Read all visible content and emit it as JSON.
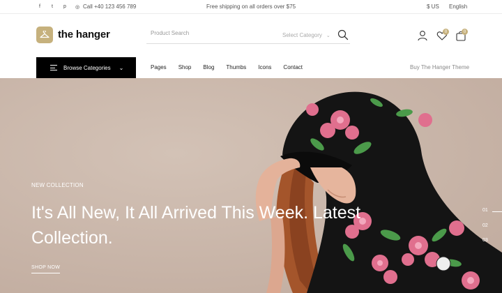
{
  "topbar": {
    "social": [
      {
        "icon": "facebook-icon",
        "glyph": "f"
      },
      {
        "icon": "twitter-icon",
        "glyph": "t"
      },
      {
        "icon": "pinterest-icon",
        "glyph": "p"
      },
      {
        "icon": "instagram-icon",
        "glyph": "◎"
      }
    ],
    "phone": "Call +40 123 456 789",
    "shipping": "Free shipping on all orders over $75",
    "currency": "$ US",
    "language": "English"
  },
  "header": {
    "logo_text": "the hanger",
    "search_placeholder": "Product Search",
    "category_select": "Select Category",
    "wishlist_count": "0",
    "cart_count": "0"
  },
  "nav": {
    "browse_label": "Browse Categories",
    "items": [
      "Pages",
      "Shop",
      "Blog",
      "Thumbs",
      "Icons",
      "Contact"
    ],
    "theme_link": "Buy The Hanger Theme"
  },
  "hero": {
    "label": "NEW COLLECTION",
    "title": "It's All New, It All Arrived This Week. Latest Collection.",
    "cta": "SHOP NOW",
    "slides": [
      "01",
      "02",
      "03"
    ]
  },
  "colors": {
    "accent": "#c6b17d",
    "hero_bg": "#cbb7aa",
    "nav_dark": "#000000"
  }
}
